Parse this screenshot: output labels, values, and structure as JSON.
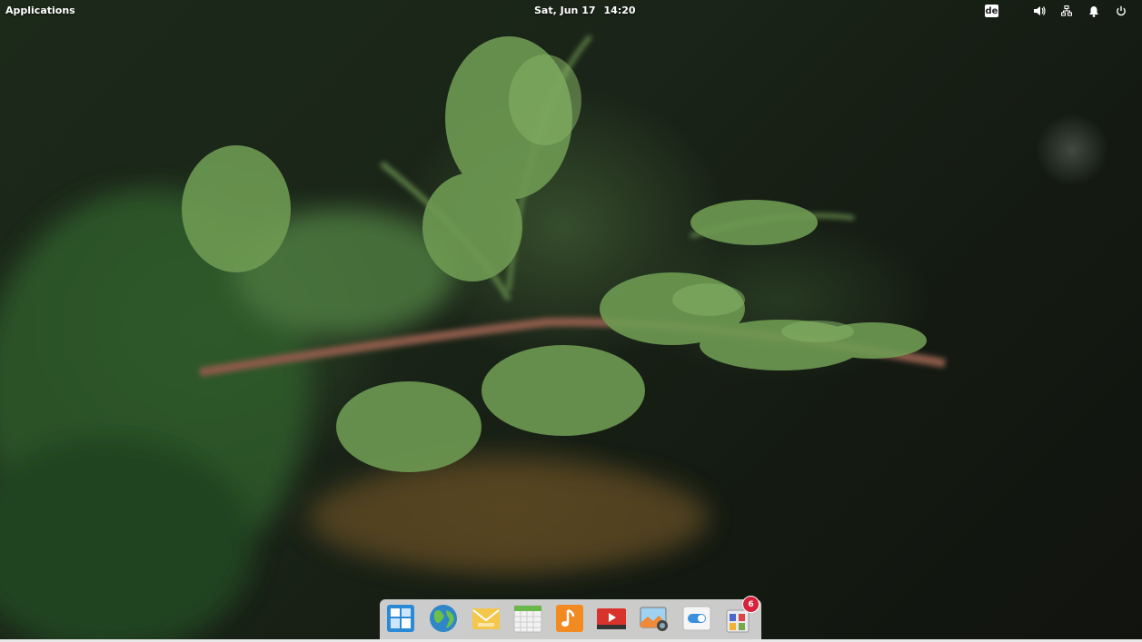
{
  "panel": {
    "applications_label": "Applications",
    "date": "Sat, Jun 17",
    "time": "14:20",
    "keyboard_layout": "de"
  },
  "icons": {
    "volume": "speaker-icon",
    "network": "network-wired-icon",
    "notifications": "bell-icon",
    "power": "power-icon"
  },
  "dock": {
    "items": [
      {
        "name": "multitasking-view",
        "icon": "multitasking-icon"
      },
      {
        "name": "web-browser",
        "icon": "globe-icon"
      },
      {
        "name": "mail",
        "icon": "envelope-icon"
      },
      {
        "name": "calendar",
        "icon": "calendar-icon"
      },
      {
        "name": "music",
        "icon": "music-note-icon"
      },
      {
        "name": "videos",
        "icon": "video-play-icon"
      },
      {
        "name": "photos",
        "icon": "photos-icon"
      },
      {
        "name": "system-settings",
        "icon": "toggle-switch-icon"
      },
      {
        "name": "app-center",
        "icon": "shopping-bag-icon"
      }
    ],
    "app_center_badge": "6"
  }
}
